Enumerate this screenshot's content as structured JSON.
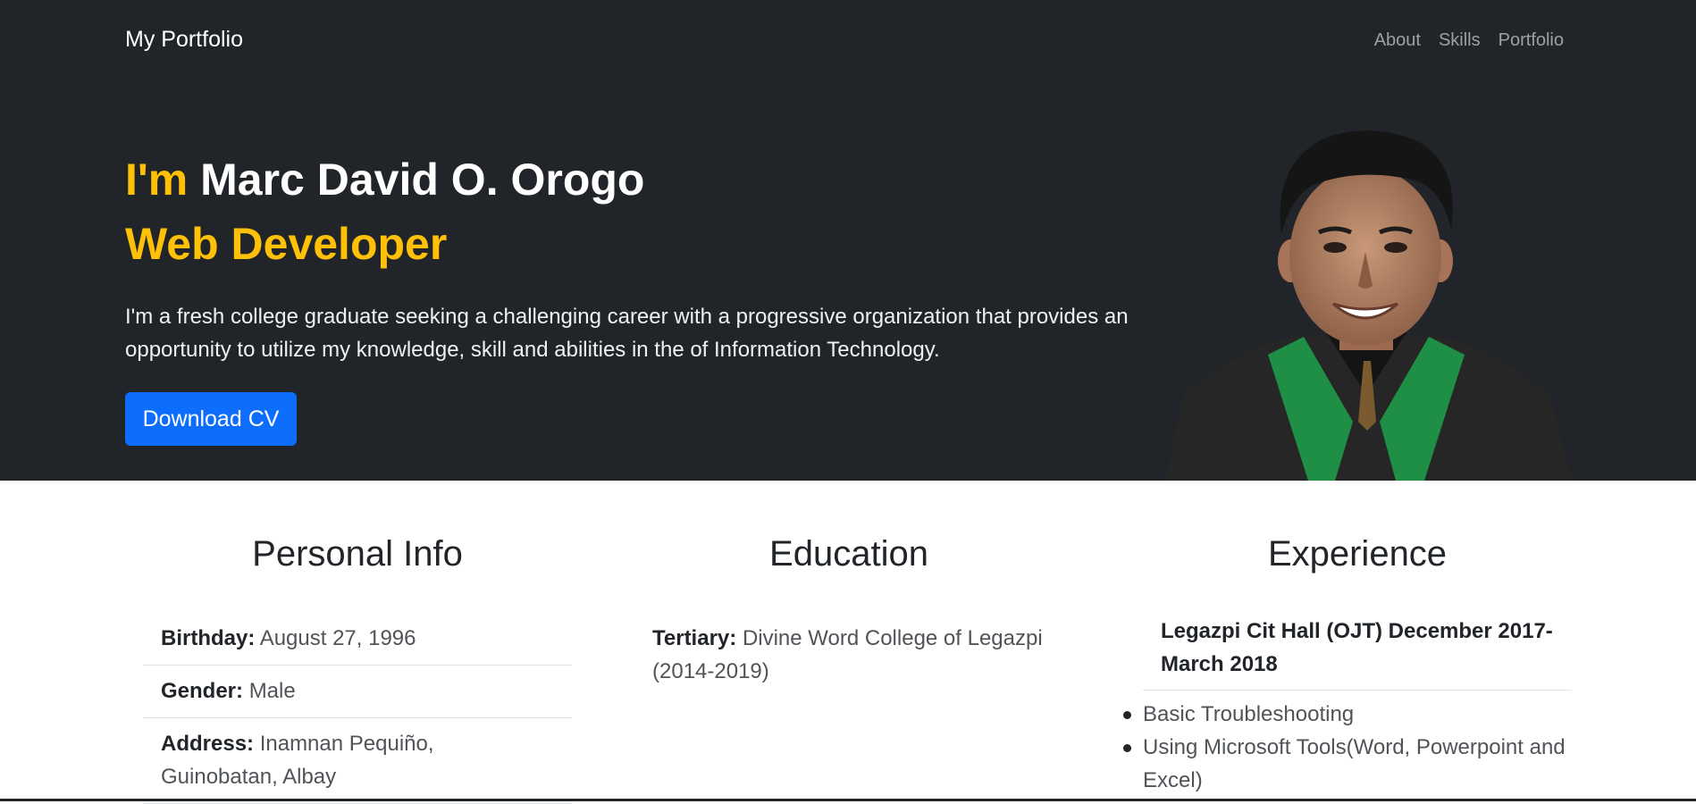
{
  "navbar": {
    "brand": "My Portfolio",
    "links": [
      "About",
      "Skills",
      "Portfolio"
    ]
  },
  "hero": {
    "greeting": "I'm",
    "name": " Marc David O. Orogo",
    "role": "Web Developer",
    "bio": "I'm a fresh college graduate seeking a challenging career with a progressive organization that provides an opportunity to utilize my knowledge, skill and abilities in the of Information Technology.",
    "cta_label": "Download CV",
    "accent_color": "#ffc107",
    "cta_color": "#0d6efd",
    "background": "#212529"
  },
  "personal": {
    "heading": "Personal Info",
    "rows": [
      {
        "label": "Birthday:",
        "value": "August 27, 1996"
      },
      {
        "label": "Gender:",
        "value": "Male"
      },
      {
        "label": "Address:",
        "value": "Inamnan Pequiño, Guinobatan, Albay"
      }
    ]
  },
  "education": {
    "heading": "Education",
    "label": "Tertiary:",
    "value": "Divine Word College of Legazpi (2014-2019)"
  },
  "experience": {
    "heading": "Experience",
    "title": "Legazpi Cit Hall (OJT) December 2017-March 2018",
    "duties": [
      "Basic Troubleshooting",
      "Using Microsoft Tools(Word, Powerpoint and Excel)"
    ]
  }
}
